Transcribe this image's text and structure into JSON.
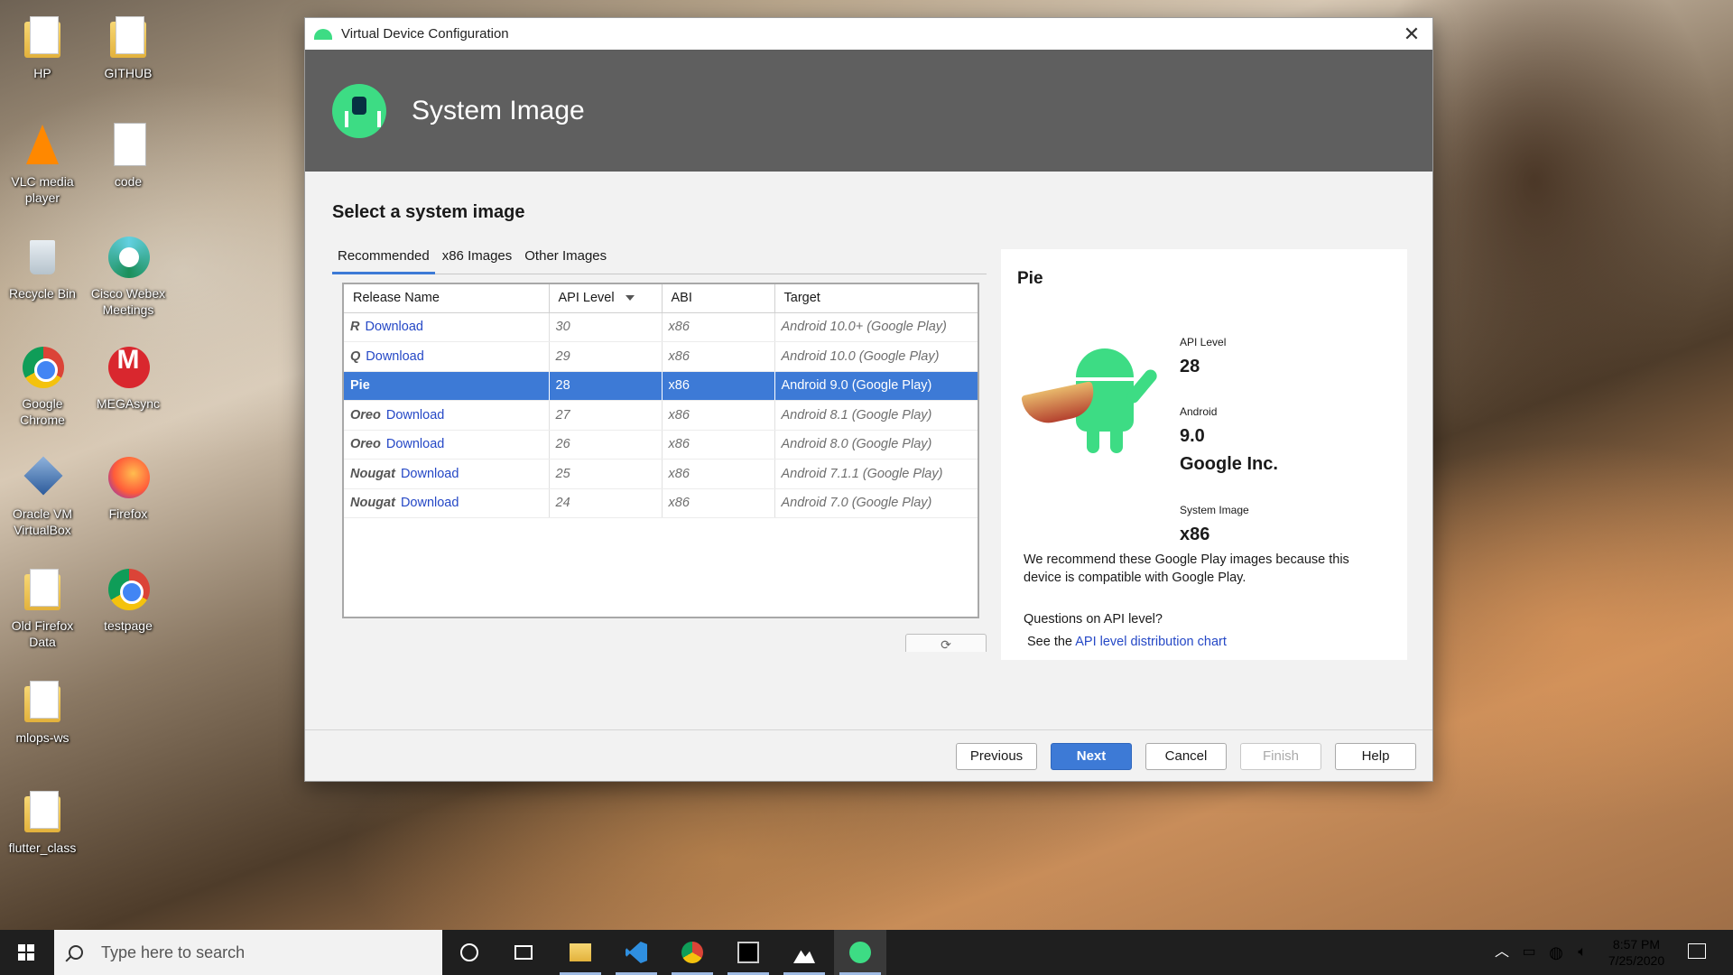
{
  "desktop": {
    "icons": [
      {
        "label": "HP"
      },
      {
        "label": "GITHUB"
      },
      {
        "label": "VLC media player"
      },
      {
        "label": "code"
      },
      {
        "label": "Recycle Bin"
      },
      {
        "label": "Cisco Webex Meetings"
      },
      {
        "label": "Google Chrome"
      },
      {
        "label": "MEGAsync"
      },
      {
        "label": "Oracle VM VirtualBox"
      },
      {
        "label": "Firefox"
      },
      {
        "label": "Old Firefox Data"
      },
      {
        "label": "testpage"
      },
      {
        "label": "mlops-ws"
      },
      {
        "label": "flutter_class"
      }
    ]
  },
  "dialog": {
    "title": "Virtual Device Configuration",
    "close_glyph": "✕",
    "header_title": "System Image",
    "section_title": "Select a system image",
    "tabs": [
      {
        "label": "Recommended",
        "active": true
      },
      {
        "label": "x86 Images",
        "active": false
      },
      {
        "label": "Other Images",
        "active": false
      }
    ],
    "table": {
      "columns": [
        "Release Name",
        "API Level",
        "ABI",
        "Target"
      ],
      "sorted_column": "API Level",
      "rows": [
        {
          "name": "R",
          "action": "Download",
          "api": "30",
          "abi": "x86",
          "target": "Android 10.0+ (Google Play)",
          "selected": false
        },
        {
          "name": "Q",
          "action": "Download",
          "api": "29",
          "abi": "x86",
          "target": "Android 10.0 (Google Play)",
          "selected": false
        },
        {
          "name": "Pie",
          "action": "",
          "api": "28",
          "abi": "x86",
          "target": "Android 9.0 (Google Play)",
          "selected": true
        },
        {
          "name": "Oreo",
          "action": "Download",
          "api": "27",
          "abi": "x86",
          "target": "Android 8.1 (Google Play)",
          "selected": false
        },
        {
          "name": "Oreo",
          "action": "Download",
          "api": "26",
          "abi": "x86",
          "target": "Android 8.0 (Google Play)",
          "selected": false
        },
        {
          "name": "Nougat",
          "action": "Download",
          "api": "25",
          "abi": "x86",
          "target": "Android 7.1.1 (Google Play)",
          "selected": false
        },
        {
          "name": "Nougat",
          "action": "Download",
          "api": "24",
          "abi": "x86",
          "target": "Android 7.0 (Google Play)",
          "selected": false
        }
      ]
    },
    "refresh_glyph": "⟳",
    "details": {
      "title": "Pie",
      "api_level_label": "API Level",
      "api_level_value": "28",
      "android_label": "Android",
      "android_version": "9.0",
      "vendor": "Google Inc.",
      "system_image_label": "System Image",
      "system_image_value": "x86",
      "recommendation_line1": "We recommend these Google Play images because this",
      "recommendation_line2": "device is compatible with Google Play.",
      "question": "Questions on API level?",
      "see_the": "See the",
      "chart_link": "API level distribution chart"
    },
    "buttons": {
      "previous": "Previous",
      "next": "Next",
      "cancel": "Cancel",
      "finish": "Finish",
      "help": "Help"
    }
  },
  "taskbar": {
    "search_placeholder": "Type here to search",
    "time": "8:57 PM",
    "date": "7/25/2020"
  }
}
